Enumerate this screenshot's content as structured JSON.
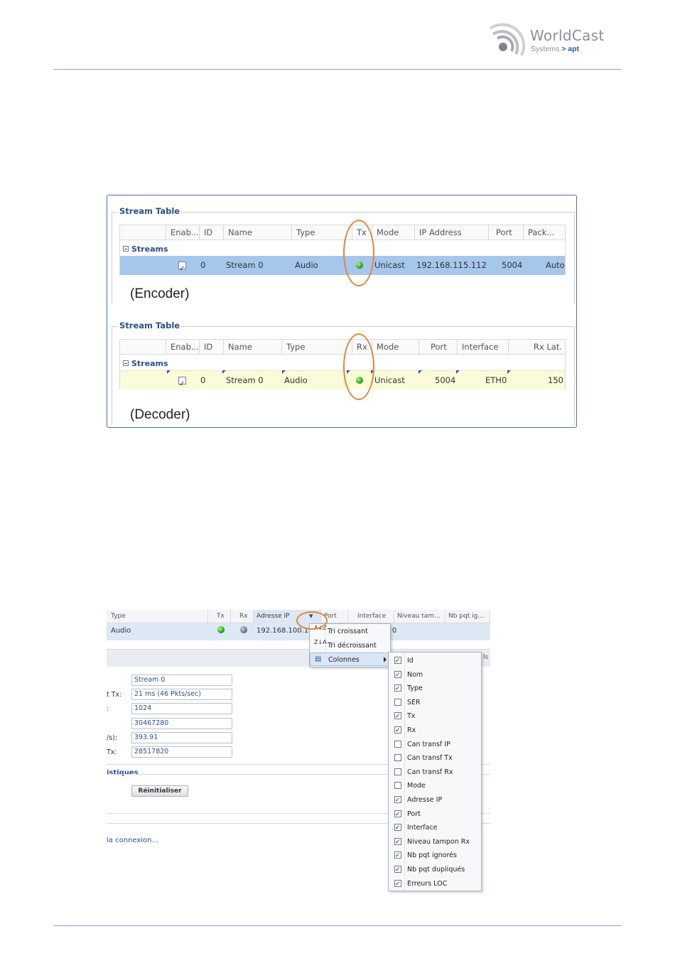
{
  "header": {
    "logo_word": "WorldCast",
    "logo_sub_plain": "Systems ",
    "logo_sub_brand": "> apt"
  },
  "encoder_table": {
    "legend": "Stream Table",
    "columns": [
      "Enab...",
      "ID",
      "Name",
      "Type",
      "Tx",
      "Mode",
      "IP Address",
      "Port",
      "Pack..."
    ],
    "group": "Streams",
    "row": {
      "enabled": true,
      "id": "0",
      "name": "Stream 0",
      "type": "Audio",
      "status": "green",
      "mode": "Unicast",
      "ip": "192.168.115.112",
      "port": "5004",
      "pack": "Auto"
    },
    "caption": "(Encoder)"
  },
  "decoder_table": {
    "legend": "Stream Table",
    "columns": [
      "Enab...",
      "ID",
      "Name",
      "Type",
      "Rx",
      "Mode",
      "Port",
      "Interface",
      "Rx Lat."
    ],
    "group": "Streams",
    "row": {
      "enabled": true,
      "id": "0",
      "name": "Stream 0",
      "type": "Audio",
      "status": "green",
      "mode": "Unicast",
      "port": "5004",
      "interface": "ETH0",
      "rx_lat": "150"
    },
    "caption": "(Decoder)"
  },
  "fig2": {
    "columns": [
      "Type",
      "Tx",
      "Rx",
      "Adresse IP",
      "Port",
      "Interface",
      "Niveau tam...",
      "Nb pqt ig..."
    ],
    "row": {
      "type": "Audio",
      "ip": "192.168.100.13",
      "port_fragment": "0"
    },
    "partial_text": "ls",
    "fields": [
      {
        "label": "",
        "value": "Stream 0"
      },
      {
        "label": "t Tx:",
        "value": "21 ms (46 Pkts/sec)"
      },
      {
        "label": ":",
        "value": "1024"
      },
      {
        "label": "",
        "value": "30467280"
      },
      {
        "label": "/s):",
        "value": "393.91"
      },
      {
        "label": "Tx:",
        "value": "28517820"
      }
    ],
    "section_title": "istiques",
    "reset_button": "Réinitialiser",
    "link": "la connexion...",
    "menu": [
      {
        "label": "Tri croissant",
        "icon": "sort-asc-icon",
        "glyph": "A↓Z"
      },
      {
        "label": "Tri décroissant",
        "icon": "sort-desc-icon",
        "glyph": "Z↓A"
      },
      {
        "label": "Colonnes",
        "icon": "columns-icon",
        "glyph": "▤"
      }
    ],
    "columns_menu": [
      {
        "label": "Id",
        "checked": true
      },
      {
        "label": "Nom",
        "checked": true
      },
      {
        "label": "Type",
        "checked": true
      },
      {
        "label": "SER",
        "checked": false
      },
      {
        "label": "Tx",
        "checked": true
      },
      {
        "label": "Rx",
        "checked": true
      },
      {
        "label": "Can transf IP",
        "checked": false
      },
      {
        "label": "Can transf Tx",
        "checked": false
      },
      {
        "label": "Can transf Rx",
        "checked": false
      },
      {
        "label": "Mode",
        "checked": false
      },
      {
        "label": "Adresse IP",
        "checked": true
      },
      {
        "label": "Port",
        "checked": true
      },
      {
        "label": "Interface",
        "checked": true
      },
      {
        "label": "Niveau tampon Rx",
        "checked": true
      },
      {
        "label": "Nb pqt ignorés",
        "checked": true
      },
      {
        "label": "Nb pqt dupliqués",
        "checked": true
      },
      {
        "label": "Erreurs LOC",
        "checked": true
      }
    ]
  },
  "colors": {
    "accent": "#2b4f8a",
    "highlight_ring": "#e2873c",
    "selected_row": "#a6c6ec",
    "decoder_row": "#fbfbd9"
  }
}
